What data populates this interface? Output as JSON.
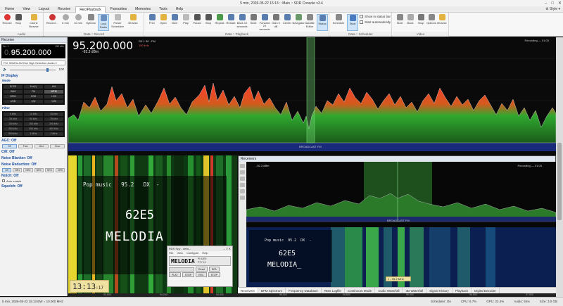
{
  "window": {
    "title": "5 min, 2026-05-22 15:13 :: Main :: SDR Console v3.4"
  },
  "menu": {
    "items": [
      "Home",
      "View",
      "Layout",
      "Receive",
      "Rec/Playback",
      "Favourites",
      "Memories",
      "Tools",
      "Help"
    ],
    "active": "Rec/Playback",
    "style": "Style"
  },
  "ribbon": {
    "groups": {
      "audio": "Audio",
      "record": "Data :: Record",
      "playback": "Data :: Playback",
      "scheduler": "Data :: Scheduler",
      "video": "Video"
    },
    "audio_buttons": [
      "Record",
      "Stop",
      "Cache Browse"
    ],
    "record_buttons": [
      "Record...",
      "5 min",
      "10 min",
      "Options",
      "Lock Radio",
      "Power Scheduler",
      "Browse"
    ],
    "playback_buttons": [
      "Prev",
      "Open",
      "Next",
      "Play",
      "Pause",
      "Stop",
      "Repeat",
      "Restart",
      "Back 10 seconds",
      "Seek",
      "Forward 10 seconds",
      "Gain 0 dB",
      "Center",
      "Navigator",
      "Datafile Editor",
      "Status"
    ],
    "scheduler_buttons": [
      "Schedule",
      "Start"
    ],
    "scheduler_checks": [
      "Show in status bar",
      "Start automatically"
    ],
    "video_buttons": [
      "Start",
      "Back",
      "Stop",
      "Options",
      "Browse"
    ]
  },
  "left": {
    "header": "Receive",
    "vfo": {
      "label": "No. 1",
      "zero": "0.0",
      "freq": "95.200.000",
      "bw": "150 kHz"
    },
    "device": "FM, 50MHz AVIOrA High Selection Audio",
    "volume": "100",
    "if_display": "IF Display",
    "mode_title": "Mode",
    "modes": [
      "ECSS",
      "Ext(1)",
      "AM",
      "SAM",
      "FM",
      "WFM",
      "DRM",
      "DSB",
      "LSB",
      "USB",
      "CW",
      "CWl"
    ],
    "filter_title": "Filter",
    "filters": [
      "6 kHz",
      "10 kHz",
      "15 kHz",
      "25 kHz",
      "50 kHz",
      "75 kHz",
      "100 kHz",
      "150 kHz",
      "200 kHz",
      "250 kHz",
      "300 kHz",
      "400 kHz",
      "500 kHz",
      "1 MHz",
      "2 MHz"
    ],
    "agc": "AGC: Off",
    "agc_buttons": [
      "Off",
      "Fast",
      "Med",
      "Slow"
    ],
    "cw": "CW: Off",
    "noise_blanker": "Noise Blanker: Off",
    "noise_reduction": "Noise Reduction: Off",
    "nr_buttons": [
      "Off",
      "NR1",
      "NR2",
      "NR3",
      "NR4",
      "NR5"
    ],
    "notch": "Notch: Off",
    "auto_enable": "Auto enable",
    "squelch": "Squelch: Off"
  },
  "spectrum": {
    "freq": "95.200.000",
    "db": "-92.3 dBm",
    "tags": "RX 1  90 - FM",
    "tags2": "150 kHz",
    "rec": "Recording — 01:05",
    "broadcast": "BROADCAST FM"
  },
  "rds": {
    "top": "Pop music   95.2   DX  -",
    "pi": "62E5",
    "ps": "MELODIA",
    "clock": "13:13",
    "clock_sec": ":17"
  },
  "rds_spy": {
    "title": "RDS Spy - defa...",
    "menu": [
      "File",
      "View",
      "Configure",
      "Help"
    ],
    "ps": "MELODIA",
    "pi": "PI 62E5",
    "pty": "PTY 10",
    "buttons": [
      "PLAY",
      "STOP",
      "Reset",
      "REC",
      "STOP"
    ],
    "unit": "BFA"
  },
  "receivers": {
    "header": "Receivers",
    "db": "-92.3 dBm",
    "rec": "Recording — 01:05",
    "broadcast": "BROADCAST FM",
    "rds_top": "Pop music  95.2  DX  -",
    "pi": "62E5",
    "ps": "MELODIA_",
    "marker": "1 - 95.2 MHz"
  },
  "tabs": [
    "Receivers",
    "BFM Spectrum",
    "Frequency Database",
    "RDS Logfile",
    "Continuum Mode",
    "Audio Waterfall",
    "3D Waterfall",
    "Signal History",
    "Playback",
    "Digital Decoder"
  ],
  "axis_labels": [
    "93.500",
    "94.000",
    "94.500",
    "95.000",
    "95.500",
    "96.000",
    "96.500",
    "97.000"
  ],
  "status": {
    "left": "5 min, 2026-05-22 15:13  BW = 10.000 MHz",
    "scheduler": "Scheduler: On",
    "cpu": "CPU: 6.7%",
    "gpu": "GPU: 22.4%",
    "audio": "Audio: 5ms",
    "size": "Size: 3.0 GB"
  },
  "colors": {
    "accent": "#1a4fa0",
    "spectrum_peak": "#ff3b2f",
    "spectrum_body": "#2fa82f"
  }
}
